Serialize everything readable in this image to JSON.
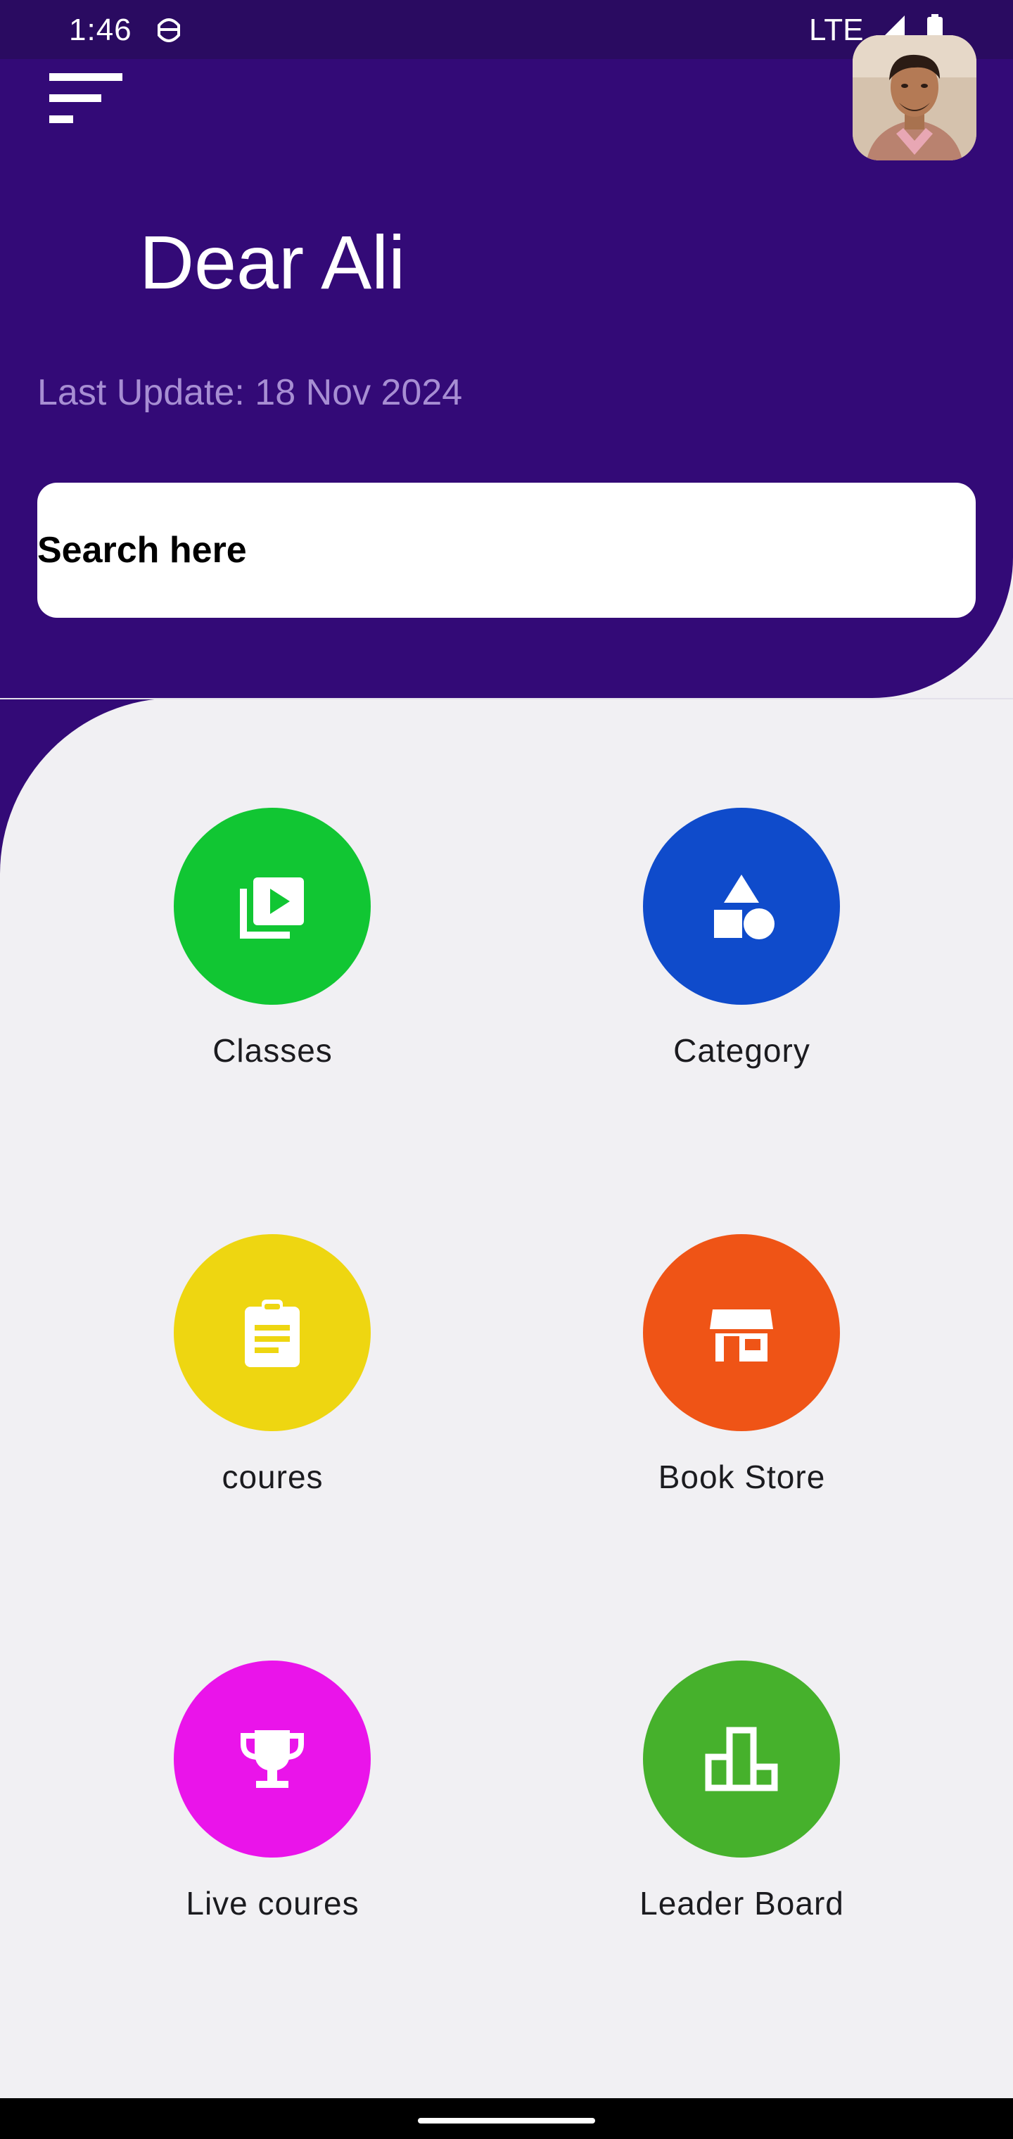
{
  "status_bar": {
    "time": "1:46",
    "network": "LTE",
    "notification_icon": "android-debug-icon",
    "signal_icon": "cell-signal-icon",
    "battery_icon": "battery-icon"
  },
  "header": {
    "greeting": "Dear Ali",
    "last_update": "Last Update: 18 Nov 2024",
    "menu_icon": "menu-sort-icon",
    "avatar_alt": "profile-photo"
  },
  "search": {
    "placeholder": "Search here",
    "value": ""
  },
  "colors": {
    "header_bg": "#330a77",
    "status_bg": "#2a0b61",
    "content_bg": "#f1f0f3",
    "subtitle": "#a78ed3"
  },
  "tiles": [
    {
      "label": "Classes",
      "icon": "video-library-icon",
      "color": "#11c633"
    },
    {
      "label": "Category",
      "icon": "category-shapes-icon",
      "color": "#0f4bcb"
    },
    {
      "label": "coures",
      "icon": "clipboard-icon",
      "color": "#eed611"
    },
    {
      "label": "Book Store",
      "icon": "storefront-icon",
      "color": "#ef5416"
    },
    {
      "label": "Live coures",
      "icon": "trophy-icon",
      "color": "#ea14ea"
    },
    {
      "label": "Leader Board",
      "icon": "leaderboard-icon",
      "color": "#46b12c"
    }
  ]
}
